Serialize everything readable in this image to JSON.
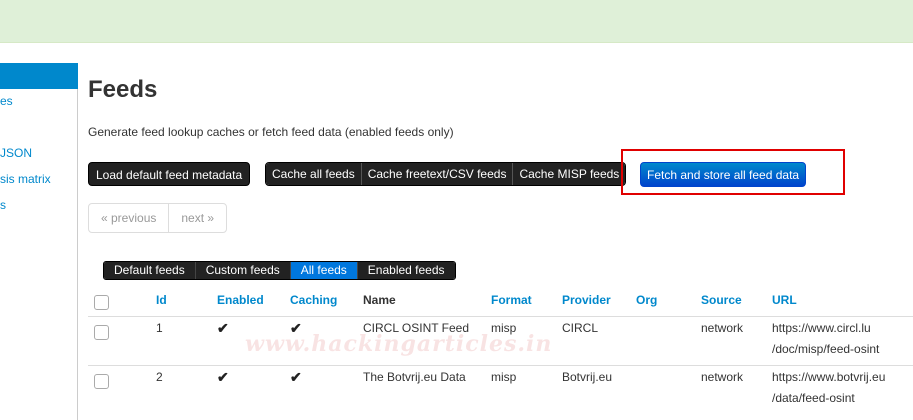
{
  "sidebar": {
    "items": [
      {
        "label": "es"
      },
      {
        "label": "JSON"
      },
      {
        "label": "sis matrix"
      },
      {
        "label": "s"
      }
    ]
  },
  "page": {
    "title": "Feeds",
    "description": "Generate feed lookup caches or fetch feed data (enabled feeds only)"
  },
  "actions": {
    "load_default": "Load default feed metadata",
    "cache_all": "Cache all feeds",
    "cache_freetext": "Cache freetext/CSV feeds",
    "cache_misp": "Cache MISP feeds",
    "fetch_store": "Fetch and store all feed data"
  },
  "pagination": {
    "previous": "« previous",
    "next": "next »"
  },
  "filters": {
    "default": "Default feeds",
    "custom": "Custom feeds",
    "all": "All feeds",
    "enabled": "Enabled feeds",
    "active": "All feeds"
  },
  "table": {
    "headers": {
      "id": "Id",
      "enabled": "Enabled",
      "caching": "Caching",
      "name": "Name",
      "format": "Format",
      "provider": "Provider",
      "org": "Org",
      "source": "Source",
      "url": "URL"
    },
    "rows": [
      {
        "id": "1",
        "enabled": "✔",
        "caching": "✔",
        "name": "CIRCL OSINT Feed",
        "format": "misp",
        "provider": "CIRCL",
        "org": "",
        "source": "network",
        "url_line1": "https://www.circl.lu",
        "url_line2": "/doc/misp/feed-osint"
      },
      {
        "id": "2",
        "enabled": "✔",
        "caching": "✔",
        "name": "The Botvrij.eu Data",
        "format": "misp",
        "provider": "Botvrij.eu",
        "org": "",
        "source": "network",
        "url_line1": "https://www.botvrij.eu",
        "url_line2": "/data/feed-osint"
      }
    ]
  },
  "watermark": "www.hackingarticles.in",
  "colors": {
    "accent": "#0088cc",
    "success_bar": "#dff0d8",
    "highlight_box": "#e00000",
    "dark_button": "#222222",
    "primary_button": "#0055cc"
  }
}
